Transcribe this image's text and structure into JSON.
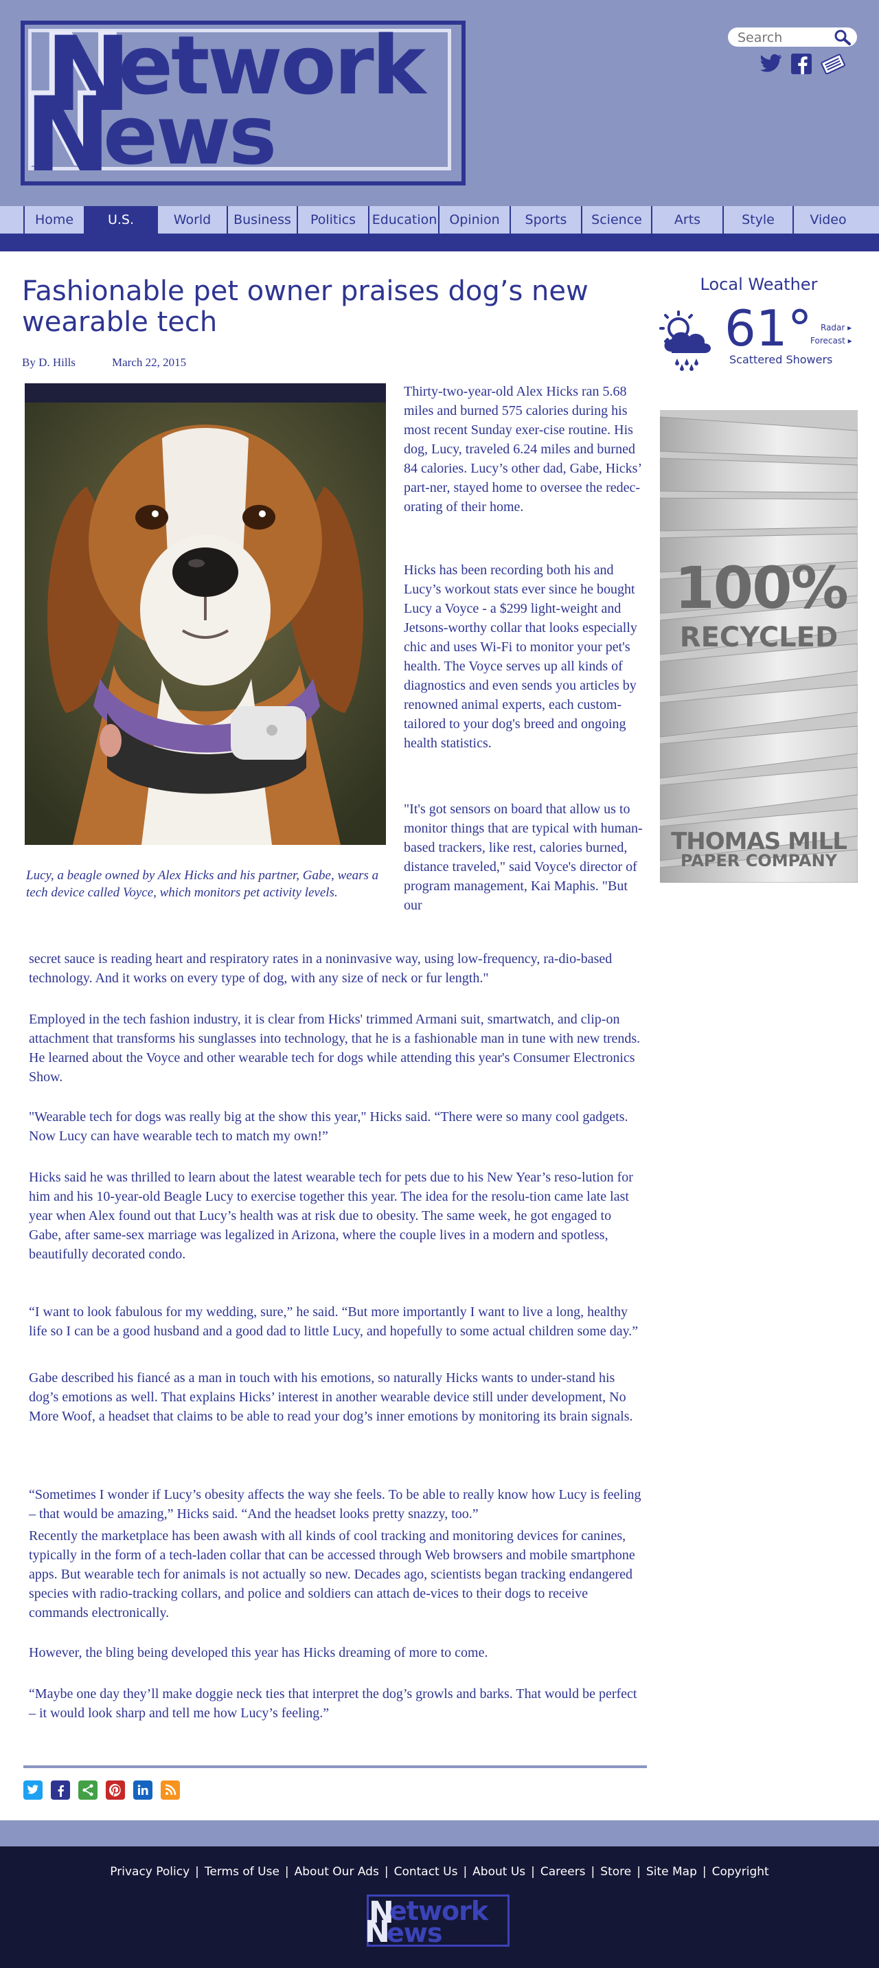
{
  "site": {
    "logo_line1": "etwork",
    "logo_line2": "ews",
    "logo_initial": "N"
  },
  "search": {
    "placeholder": "Search",
    "value": "Search"
  },
  "social_top": [
    "twitter-icon",
    "facebook-icon",
    "newspaper-icon"
  ],
  "nav": [
    "Home",
    "U.S.",
    "World",
    "Business",
    "Politics",
    "Education",
    "Opinion",
    "Sports",
    "Science",
    "Arts",
    "Style",
    "Video"
  ],
  "nav_active": "U.S.",
  "article": {
    "headline": "Fashionable pet owner praises dog’s new wearable tech",
    "byline": "By D. Hills",
    "date": "March 22, 2015",
    "caption": "Lucy, a beagle owned by Alex Hicks and his partner, Gabe, wears a tech device called Voyce, which monitors pet activity levels.",
    "narrow_paragraphs": [
      "Thirty-two-year-old Alex Hicks ran 5.68 miles and burned 575 calories during his most recent Sunday exer-cise routine. His dog, Lucy, traveled 6.24 miles and burned 84 calories. Lucy’s other dad, Gabe, Hicks’ part-ner, stayed home to oversee the redec-orating of their home.",
      "Hicks has been recording both his and Lucy’s workout stats ever since he bought Lucy a Voyce - a $299 light-weight and Jetsons-worthy collar that looks especially chic and uses Wi-Fi to monitor your pet's health. The Voyce serves up all kinds of diagnostics and even sends you articles by renowned animal experts, each custom-tailored to your dog's breed and ongoing health statistics.",
      "\"It's got sensors on board that allow us to monitor things that are typical with human-based trackers, like rest, calories burned, distance traveled,\" said Voyce's director of program management, Kai Maphis. \"But our"
    ],
    "wide_paragraphs": [
      "secret sauce is reading heart and respiratory rates in a noninvasive way, using low-frequency, ra-dio-based technology. And it works on every type of dog, with any size of neck or fur length.\"",
      "Employed in the tech fashion industry, it is clear from Hicks' trimmed Armani suit, smartwatch, and clip-on attachment that transforms his sunglasses into technology, that he is a fashionable man in tune with new trends. He learned about the Voyce and other wearable tech for dogs while attending this year's Consumer Electronics Show.",
      "\"Wearable tech for dogs was really big at the show this year,\" Hicks said. “There were so many cool gadgets. Now Lucy can have wearable tech to match my own!”",
      "Hicks said he was thrilled to learn about the latest wearable tech for pets due to his New Year’s reso-lution for him and his 10-year-old Beagle Lucy to exercise together this year. The idea for the resolu-tion came late last year when Alex found out that Lucy’s health was at risk due to obesity. The same week, he got engaged to Gabe, after same-sex marriage was legalized in Arizona, where the couple lives in a modern and spotless, beautifully decorated condo.",
      "“I want to look fabulous for my wedding, sure,” he said. “But more importantly I want to live a long, healthy life so I can be a good husband and a good dad to little Lucy, and hopefully to some actual children some day.”",
      "Gabe described his fiancé as a man in touch with his emotions, so naturally Hicks wants to under-stand his dog’s emotions as well. That explains Hicks’ interest in another wearable device still under development, No More Woof, a headset that claims to be able to read your dog’s inner emotions by monitoring its brain signals.",
      "“Sometimes I wonder if Lucy’s obesity affects the way she feels. To be able to really know how Lucy is feeling – that would be amazing,” Hicks said. “And the headset looks pretty snazzy, too.”",
      "Recently the marketplace has been awash with all kinds of cool tracking and monitoring devices for canines, typically in the form of a tech-laden collar that can be accessed through Web browsers and mobile smartphone apps. But wearable tech for animals is not actually so new. Decades ago, scientists began tracking endangered species with radio-tracking collars, and police and soldiers can attach de-vices to their dogs to receive commands electronically.",
      "However, the bling being developed this year has Hicks dreaming of more to come.",
      "“Maybe one day they’ll make doggie neck ties that interpret the dog’s growls and barks. That would be perfect – it would look sharp and tell me how Lucy’s feeling.”"
    ]
  },
  "share_icons": [
    {
      "name": "twitter-icon",
      "color": "#1da1f2"
    },
    {
      "name": "facebook-icon",
      "color": "#2e3591"
    },
    {
      "name": "share-icon",
      "color": "#43a047"
    },
    {
      "name": "pinterest-icon",
      "color": "#c62828"
    },
    {
      "name": "linkedin-icon",
      "color": "#1565c0"
    },
    {
      "name": "rss-icon",
      "color": "#f7931e"
    }
  ],
  "weather": {
    "title": "Local Weather",
    "temp": "61°",
    "radar": "Radar ▸",
    "forecast": "Forecast ▸",
    "condition": "Scattered Showers"
  },
  "ad": {
    "big": "100%",
    "recycled": "RECYCLED",
    "company1": "THOMAS MILL",
    "company2": "PAPER COMPANY"
  },
  "footer": {
    "links": [
      "Privacy Policy",
      "Terms of Use",
      "About Our Ads",
      "Contact Us",
      "About Us",
      "Careers",
      "Store",
      "Site Map",
      "Copyright"
    ]
  },
  "colors": {
    "brand": "#2e3591",
    "header_bg": "#8a95c2",
    "nav_bg": "#c3cbee",
    "footer_bg": "#151736"
  }
}
